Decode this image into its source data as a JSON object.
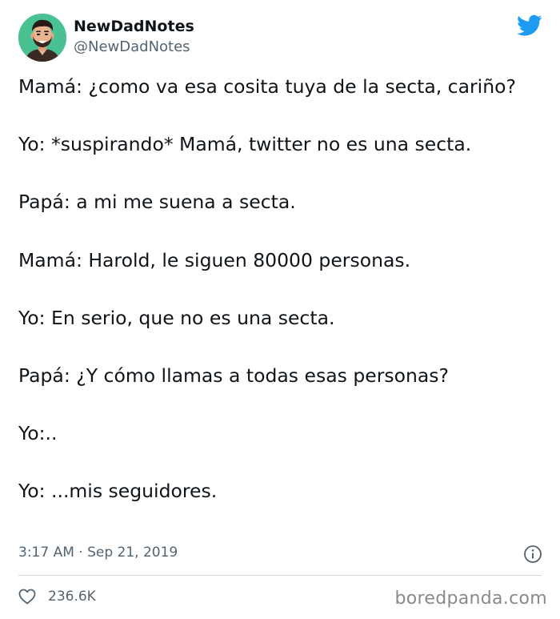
{
  "header": {
    "display_name": "NewDadNotes",
    "handle": "@NewDadNotes",
    "logo_icon": "twitter-bird-icon",
    "brand_color": "#1d9bf0"
  },
  "tweet": {
    "lines": [
      "Mamá: ¿como va esa cosita tuya de la secta, cariño?",
      "Yo: *suspirando* Mamá, twitter no es una secta.",
      "Papá: a mi me suena a secta.",
      "Mamá: Harold, le siguen 80000 personas.",
      "Yo: En serio, que no es una secta.",
      "Papá: ¿Y cómo llamas a todas esas personas?",
      "Yo:..",
      "Yo: ...mis seguidores."
    ]
  },
  "meta": {
    "time": "3:17 AM · Sep 21, 2019",
    "info_icon": "info-icon"
  },
  "engagement": {
    "like_icon": "heart-icon",
    "likes": "236.6K"
  },
  "watermark": {
    "text": "boredpanda.com"
  }
}
